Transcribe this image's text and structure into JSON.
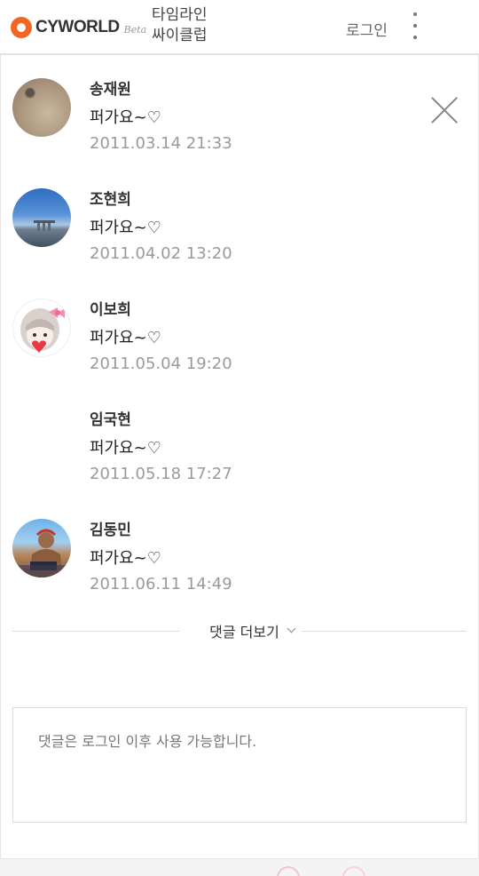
{
  "header": {
    "logo_text": "CYWORLD",
    "logo_beta": "Beta",
    "nav_timeline": "타임라인",
    "nav_cyclub": "싸이클럽",
    "login_label": "로그인"
  },
  "comments": [
    {
      "name": "송재원",
      "text": "퍼가요~♡",
      "date": "2011.03.14 21:33"
    },
    {
      "name": "조현희",
      "text": "퍼가요~♡",
      "date": "2011.04.02 13:20"
    },
    {
      "name": "이보희",
      "text": "퍼가요~♡",
      "date": "2011.05.04 19:20"
    },
    {
      "name": "임국현",
      "text": "퍼가요~♡",
      "date": "2011.05.18 17:27"
    },
    {
      "name": "김동민",
      "text": "퍼가요~♡",
      "date": "2011.06.11 14:49"
    }
  ],
  "more_comments_label": "댓글 더보기",
  "comment_input": {
    "placeholder": "댓글은 로그인 이후 사용 가능합니다."
  },
  "colors": {
    "brand": "#f26522",
    "date": "#9a9a9a",
    "border": "#dcdcdc"
  }
}
